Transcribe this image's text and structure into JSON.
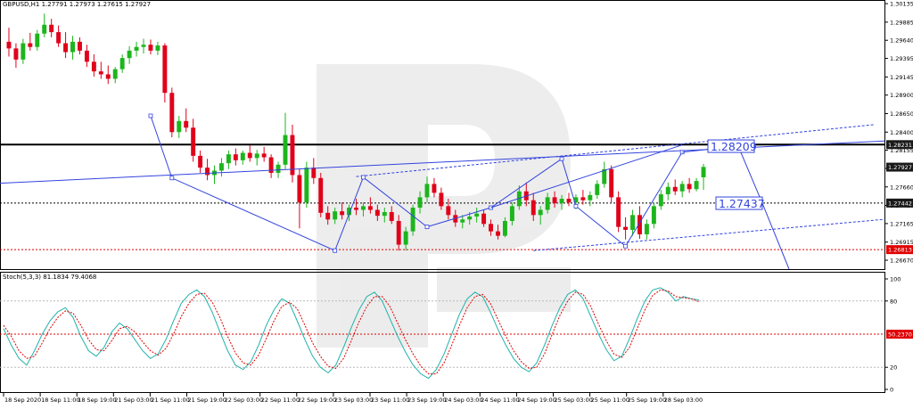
{
  "header": {
    "symbol_line": "GBPUSD,H1  1.27791 1.27973 1.27615 1.27927",
    "indicator_line": "Stoch(5,3,3) 81.1834 79.4068"
  },
  "chart_data": [
    {
      "type": "candlestick",
      "symbol": "GBPUSD",
      "timeframe": "H1",
      "ohlc_last": {
        "open": 1.27791,
        "high": 1.27973,
        "low": 1.27615,
        "close": 1.27927
      },
      "ylim": [
        1.2655,
        1.3016
      ],
      "y_ticks": [
        "1.30135",
        "1.29885",
        "1.29640",
        "1.29395",
        "1.29145",
        "1.28900",
        "1.28650",
        "1.28400",
        "1.28155",
        "1.27910",
        "1.27660",
        "1.27410",
        "1.27165",
        "1.26915",
        "1.26670"
      ],
      "x_ticks": [
        "18 Sep 2020",
        "18 Sep 11:00",
        "18 Sep 19:00",
        "21 Sep 03:00",
        "21 Sep 11:00",
        "21 Sep 19:00",
        "22 Sep 03:00",
        "22 Sep 11:00",
        "22 Sep 19:00",
        "23 Sep 03:00",
        "23 Sep 11:00",
        "23 Sep 19:00",
        "24 Sep 03:00",
        "24 Sep 11:00",
        "24 Sep 19:00",
        "25 Sep 03:00",
        "25 Sep 11:00",
        "25 Sep 19:00",
        "28 Sep 03:00"
      ],
      "price_labels": [
        {
          "value": "1.28231",
          "style": "dark",
          "line": "solid-black"
        },
        {
          "value": "1.27927",
          "style": "dark",
          "line": "none"
        },
        {
          "value": "1.27442",
          "style": "dark",
          "line": "dashed-black"
        },
        {
          "value": "1.26813",
          "style": "red",
          "line": "dashed-red"
        }
      ],
      "annotations": [
        {
          "text": "1.28209",
          "price": 1.2821,
          "color": "#3344dd"
        },
        {
          "text": "1.27437",
          "price": 1.2744,
          "color": "#3344dd"
        }
      ],
      "candles": [
        [
          1.2962,
          1.2981,
          1.2942,
          1.2953
        ],
        [
          1.2953,
          1.296,
          1.2927,
          1.2938
        ],
        [
          1.2938,
          1.2966,
          1.2932,
          1.296
        ],
        [
          1.296,
          1.2974,
          1.295,
          1.2955
        ],
        [
          1.2955,
          1.2978,
          1.295,
          1.2973
        ],
        [
          1.2973,
          1.3,
          1.2968,
          1.2985
        ],
        [
          1.2985,
          1.2993,
          1.2968,
          1.2975
        ],
        [
          1.2975,
          1.2984,
          1.2955,
          1.296
        ],
        [
          1.296,
          1.2975,
          1.294,
          1.2948
        ],
        [
          1.2948,
          1.297,
          1.2938,
          1.2962
        ],
        [
          1.2962,
          1.2968,
          1.2945,
          1.295
        ],
        [
          1.295,
          1.2958,
          1.2928,
          1.2935
        ],
        [
          1.2935,
          1.2945,
          1.2915,
          1.2922
        ],
        [
          1.2922,
          1.2935,
          1.2912,
          1.2918
        ],
        [
          1.2918,
          1.293,
          1.2905,
          1.2912
        ],
        [
          1.2912,
          1.2928,
          1.2906,
          1.2925
        ],
        [
          1.2925,
          1.2945,
          1.292,
          1.294
        ],
        [
          1.294,
          1.2956,
          1.2932,
          1.295
        ],
        [
          1.295,
          1.2962,
          1.2942,
          1.2955
        ],
        [
          1.2955,
          1.2966,
          1.2946,
          1.2958
        ],
        [
          1.2958,
          1.2965,
          1.2945,
          1.295
        ],
        [
          1.295,
          1.2962,
          1.2944,
          1.2957
        ],
        [
          1.2957,
          1.296,
          1.288,
          1.2893
        ],
        [
          1.2893,
          1.29,
          1.2833,
          1.284
        ],
        [
          1.284,
          1.2862,
          1.2832,
          1.2855
        ],
        [
          1.2855,
          1.2872,
          1.284,
          1.2846
        ],
        [
          1.2846,
          1.2858,
          1.28,
          1.2808
        ],
        [
          1.2808,
          1.2815,
          1.2785,
          1.2792
        ],
        [
          1.2792,
          1.2804,
          1.2775,
          1.2782
        ],
        [
          1.2782,
          1.2795,
          1.277,
          1.2788
        ],
        [
          1.2788,
          1.2805,
          1.278,
          1.2798
        ],
        [
          1.2798,
          1.2815,
          1.279,
          1.281
        ],
        [
          1.281,
          1.2818,
          1.2795,
          1.2802
        ],
        [
          1.2802,
          1.2815,
          1.2796,
          1.2812
        ],
        [
          1.2812,
          1.2822,
          1.28,
          1.2805
        ],
        [
          1.2805,
          1.2816,
          1.2795,
          1.2811
        ],
        [
          1.2811,
          1.282,
          1.28,
          1.2806
        ],
        [
          1.2806,
          1.281,
          1.2778,
          1.2785
        ],
        [
          1.2785,
          1.28,
          1.2778,
          1.2796
        ],
        [
          1.2796,
          1.2866,
          1.279,
          1.2836
        ],
        [
          1.2836,
          1.285,
          1.2772,
          1.2782
        ],
        [
          1.2782,
          1.279,
          1.271,
          1.2745
        ],
        [
          1.2745,
          1.28,
          1.2738,
          1.2792
        ],
        [
          1.2792,
          1.2805,
          1.277,
          1.2778
        ],
        [
          1.2778,
          1.2785,
          1.2725,
          1.2731
        ],
        [
          1.2731,
          1.274,
          1.2715,
          1.2722
        ],
        [
          1.2722,
          1.2738,
          1.2716,
          1.2733
        ],
        [
          1.2733,
          1.2745,
          1.2722,
          1.2728
        ],
        [
          1.2728,
          1.2742,
          1.272,
          1.2738
        ],
        [
          1.2738,
          1.275,
          1.2728,
          1.2735
        ],
        [
          1.2735,
          1.2745,
          1.2726,
          1.274
        ],
        [
          1.274,
          1.2752,
          1.273,
          1.2735
        ],
        [
          1.2735,
          1.2742,
          1.272,
          1.2727
        ],
        [
          1.2727,
          1.2738,
          1.2718,
          1.2732
        ],
        [
          1.2732,
          1.274,
          1.2716,
          1.272
        ],
        [
          1.272,
          1.2728,
          1.268,
          1.2688
        ],
        [
          1.2688,
          1.2712,
          1.268,
          1.2706
        ],
        [
          1.2706,
          1.2742,
          1.27,
          1.2738
        ],
        [
          1.2738,
          1.276,
          1.273,
          1.2752
        ],
        [
          1.2752,
          1.278,
          1.2745,
          1.277
        ],
        [
          1.277,
          1.2778,
          1.2752,
          1.2758
        ],
        [
          1.2758,
          1.2765,
          1.2735,
          1.274
        ],
        [
          1.274,
          1.275,
          1.2722,
          1.2728
        ],
        [
          1.2728,
          1.2735,
          1.2712,
          1.2718
        ],
        [
          1.2718,
          1.2728,
          1.271,
          1.2722
        ],
        [
          1.2722,
          1.2732,
          1.2715,
          1.2726
        ],
        [
          1.2726,
          1.2738,
          1.2718,
          1.273
        ],
        [
          1.273,
          1.2735,
          1.2712,
          1.2716
        ],
        [
          1.2716,
          1.2722,
          1.27,
          1.2706
        ],
        [
          1.2706,
          1.2715,
          1.2695,
          1.27
        ],
        [
          1.27,
          1.2725,
          1.2698,
          1.272
        ],
        [
          1.272,
          1.2745,
          1.2714,
          1.274
        ],
        [
          1.274,
          1.2768,
          1.2735,
          1.276
        ],
        [
          1.276,
          1.2772,
          1.274,
          1.2748
        ],
        [
          1.2748,
          1.2758,
          1.272,
          1.2728
        ],
        [
          1.2728,
          1.274,
          1.2715,
          1.2735
        ],
        [
          1.2735,
          1.2758,
          1.273,
          1.2752
        ],
        [
          1.2752,
          1.276,
          1.2738,
          1.2744
        ],
        [
          1.2744,
          1.2755,
          1.2735,
          1.275
        ],
        [
          1.275,
          1.2758,
          1.274,
          1.2745
        ],
        [
          1.2745,
          1.2756,
          1.2736,
          1.2752
        ],
        [
          1.2752,
          1.2762,
          1.2742,
          1.2748
        ],
        [
          1.2748,
          1.276,
          1.274,
          1.2755
        ],
        [
          1.2755,
          1.2775,
          1.275,
          1.277
        ],
        [
          1.277,
          1.28,
          1.2765,
          1.279
        ],
        [
          1.279,
          1.2795,
          1.2745,
          1.2752
        ],
        [
          1.2752,
          1.276,
          1.2705,
          1.2712
        ],
        [
          1.2712,
          1.2725,
          1.2695,
          1.2708
        ],
        [
          1.2708,
          1.2735,
          1.27,
          1.2728
        ],
        [
          1.2728,
          1.274,
          1.2696,
          1.2702
        ],
        [
          1.2702,
          1.2722,
          1.2695,
          1.2716
        ],
        [
          1.2716,
          1.2745,
          1.271,
          1.274
        ],
        [
          1.274,
          1.2762,
          1.2735,
          1.2756
        ],
        [
          1.2756,
          1.2772,
          1.2748,
          1.2766
        ],
        [
          1.2766,
          1.2776,
          1.2755,
          1.276
        ],
        [
          1.276,
          1.2774,
          1.2752,
          1.277
        ],
        [
          1.277,
          1.2778,
          1.2758,
          1.2763
        ],
        [
          1.2763,
          1.2778,
          1.276,
          1.2774
        ],
        [
          1.2779,
          1.2797,
          1.2762,
          1.2793
        ]
      ]
    },
    {
      "type": "line",
      "indicator": "Stoch(5,3,3)",
      "main_value": 81.1834,
      "signal_value": 79.4068,
      "ylim": [
        0,
        100
      ],
      "y_ticks": [
        "100",
        "80",
        "20",
        "0"
      ],
      "levels": [
        80,
        50,
        20
      ],
      "level_label": "50.2370",
      "series": [
        {
          "values": [
            55,
            40,
            28,
            22,
            35,
            50,
            62,
            70,
            74,
            65,
            48,
            35,
            30,
            38,
            52,
            60,
            55,
            45,
            35,
            28,
            32,
            45,
            62,
            78,
            86,
            90,
            84,
            70,
            52,
            35,
            22,
            18,
            25,
            40,
            58,
            72,
            82,
            78,
            62,
            45,
            30,
            20,
            15,
            22,
            38,
            56,
            72,
            84,
            88,
            80,
            64,
            48,
            34,
            22,
            14,
            10,
            18,
            32,
            50,
            68,
            82,
            88,
            84,
            70,
            54,
            40,
            28,
            20,
            16,
            24,
            40,
            58,
            74,
            86,
            90,
            82,
            66,
            50,
            36,
            26,
            30,
            46,
            64,
            80,
            90,
            92,
            88,
            80,
            84,
            82,
            81
          ]
        },
        {
          "values": [
            58,
            48,
            35,
            28,
            30,
            42,
            55,
            65,
            71,
            69,
            58,
            45,
            36,
            35,
            44,
            55,
            57,
            52,
            43,
            35,
            31,
            37,
            50,
            66,
            78,
            86,
            87,
            79,
            65,
            48,
            33,
            24,
            22,
            31,
            46,
            62,
            75,
            79,
            73,
            58,
            42,
            30,
            21,
            19,
            28,
            44,
            61,
            75,
            84,
            84,
            75,
            60,
            45,
            32,
            21,
            14,
            14,
            24,
            40,
            58,
            74,
            84,
            86,
            78,
            63,
            48,
            35,
            25,
            19,
            20,
            32,
            50,
            67,
            80,
            88,
            86,
            75,
            59,
            44,
            32,
            29,
            38,
            55,
            72,
            85,
            90,
            89,
            84,
            83,
            82,
            79.4
          ]
        }
      ]
    }
  ]
}
